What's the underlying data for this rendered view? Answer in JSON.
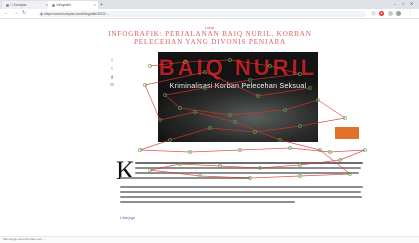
{
  "browser": {
    "tabs": [
      {
        "label": "□ Kompas"
      },
      {
        "label": "Infografis"
      }
    ],
    "window_controls": [
      "–",
      "□",
      "✕"
    ],
    "address": "https://www.kompas.com/infografik/2019/...",
    "nav": {
      "back": "←",
      "forward": "→",
      "reload": "↻"
    }
  },
  "article": {
    "category": "Lokal",
    "headline": "Infografik: Perjalanan Baiq Nuril, Korban Pelecehan yang Divonis Penjara",
    "feature": {
      "title": "BAIQ NURIL",
      "subtitle": "Kriminalisasi Korban Pelecehan Seksual"
    },
    "share_icons": [
      "f",
      "t",
      "g",
      "✉"
    ],
    "dropcap": "K",
    "read_more": "Lihat juga"
  },
  "status": "Menunggu www.kompas.com...",
  "colors": {
    "accent": "#d9615f",
    "feature_title": "#b21f24",
    "banner": "#e0702a",
    "gaze_line": "#d8342e",
    "gaze_point": "#4caf50"
  }
}
